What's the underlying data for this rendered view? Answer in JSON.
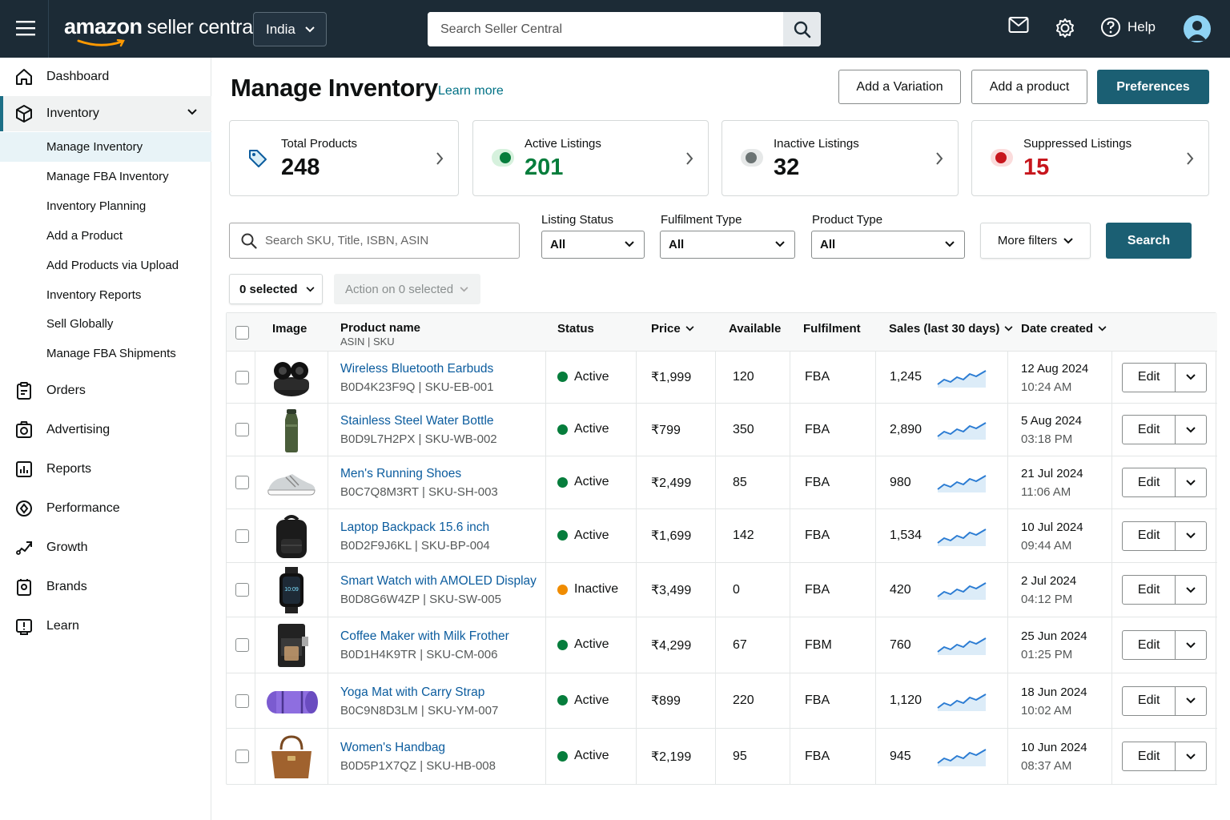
{
  "header": {
    "brand_bold": "amazon",
    "brand_light": "seller central",
    "country": "India",
    "search_placeholder": "Search Seller Central",
    "help_label": "Help"
  },
  "sidebar": {
    "items": [
      {
        "label": "Dashboard",
        "icon": "home-icon"
      },
      {
        "label": "Inventory",
        "icon": "box-icon"
      },
      {
        "label": "Orders",
        "icon": "clipboard-icon"
      },
      {
        "label": "Advertising",
        "icon": "camera-icon"
      },
      {
        "label": "Reports",
        "icon": "chart-icon"
      },
      {
        "label": "Performance",
        "icon": "target-icon"
      },
      {
        "label": "Growth",
        "icon": "growth-icon"
      },
      {
        "label": "Brands",
        "icon": "badge-icon"
      },
      {
        "label": "Learn",
        "icon": "learn-icon"
      }
    ],
    "inventory_sub": [
      "Manage Inventory",
      "Manage FBA Inventory",
      "Inventory Planning",
      "Add a Product",
      "Add Products via Upload",
      "Inventory Reports",
      "Sell Globally",
      "Manage FBA Shipments"
    ]
  },
  "page": {
    "title": "Manage Inventory",
    "learn_more": "Learn more",
    "btn_add_variation": "Add a Variation",
    "btn_add_product": "Add a product",
    "btn_preferences": "Preferences"
  },
  "cards": [
    {
      "title": "Total Products",
      "value": "248",
      "color": "#0f1111"
    },
    {
      "title": "Active Listings",
      "value": "201",
      "color": "#067d3c"
    },
    {
      "title": "Inactive Listings",
      "value": "32",
      "color": "#0f1111"
    },
    {
      "title": "Suppressed Listings",
      "value": "15",
      "color": "#c7161d"
    }
  ],
  "filters": {
    "search_placeholder": "Search SKU, Title, ISBN, ASIN",
    "listing_status_label": "Listing Status",
    "listing_status_value": "All",
    "fulfilment_label": "Fulfilment Type",
    "fulfilment_value": "All",
    "product_type_label": "Product Type",
    "product_type_value": "All",
    "more_filters": "More filters",
    "search_btn": "Search",
    "selected": "0 selected",
    "action": "Action on 0 selected"
  },
  "table": {
    "headers": {
      "image": "Image",
      "product": "Product name",
      "product_sub": "ASIN | SKU",
      "status": "Status",
      "price": "Price",
      "available": "Available",
      "fulfilment": "Fulfilment",
      "sales": "Sales (last 30 days)",
      "date": "Date created"
    },
    "edit_label": "Edit",
    "rows": [
      {
        "name": "Wireless Bluetooth Earbuds",
        "asin": "B0D4K23F9Q | SKU-EB-001",
        "status": "Active",
        "price": "₹1,999",
        "available": "120",
        "fulfilment": "FBA",
        "sales": "1,245",
        "date": "12 Aug 2024",
        "time": "10:24 AM",
        "thumb": "earbuds"
      },
      {
        "name": "Stainless Steel Water Bottle",
        "asin": "B0D9L7H2PX | SKU-WB-002",
        "status": "Active",
        "price": "₹799",
        "available": "350",
        "fulfilment": "FBA",
        "sales": "2,890",
        "date": "5 Aug 2024",
        "time": "03:18 PM",
        "thumb": "bottle"
      },
      {
        "name": "Men's Running Shoes",
        "asin": "B0C7Q8M3RT | SKU-SH-003",
        "status": "Active",
        "price": "₹2,499",
        "available": "85",
        "fulfilment": "FBA",
        "sales": "980",
        "date": "21 Jul 2024",
        "time": "11:06 AM",
        "thumb": "shoes"
      },
      {
        "name": "Laptop Backpack 15.6 inch",
        "asin": "B0D2F9J6KL | SKU-BP-004",
        "status": "Active",
        "price": "₹1,699",
        "available": "142",
        "fulfilment": "FBA",
        "sales": "1,534",
        "date": "10 Jul 2024",
        "time": "09:44 AM",
        "thumb": "backpack"
      },
      {
        "name": "Smart Watch with AMOLED Display",
        "asin": "B0D8G6W4ZP | SKU-SW-005",
        "status": "Inactive",
        "price": "₹3,499",
        "available": "0",
        "fulfilment": "FBA",
        "sales": "420",
        "date": "2 Jul 2024",
        "time": "04:12 PM",
        "thumb": "watch"
      },
      {
        "name": "Coffee Maker with Milk Frother",
        "asin": "B0D1H4K9TR | SKU-CM-006",
        "status": "Active",
        "price": "₹4,299",
        "available": "67",
        "fulfilment": "FBM",
        "sales": "760",
        "date": "25 Jun 2024",
        "time": "01:25 PM",
        "thumb": "coffee"
      },
      {
        "name": "Yoga Mat with Carry Strap",
        "asin": "B0C9N8D3LM | SKU-YM-007",
        "status": "Active",
        "price": "₹899",
        "available": "220",
        "fulfilment": "FBA",
        "sales": "1,120",
        "date": "18 Jun 2024",
        "time": "10:02 AM",
        "thumb": "yogamat"
      },
      {
        "name": "Women's Handbag",
        "asin": "B0D5P1X7QZ | SKU-HB-008",
        "status": "Active",
        "price": "₹2,199",
        "available": "95",
        "fulfilment": "FBA",
        "sales": "945",
        "date": "10 Jun 2024",
        "time": "08:37 AM",
        "thumb": "handbag"
      }
    ]
  },
  "colors": {
    "topbar": "#1c2b36",
    "primary": "#1b5f73",
    "active_dot": "#067d3c",
    "inactive_dot": "#f08c00",
    "link": "#0b5c9e"
  }
}
